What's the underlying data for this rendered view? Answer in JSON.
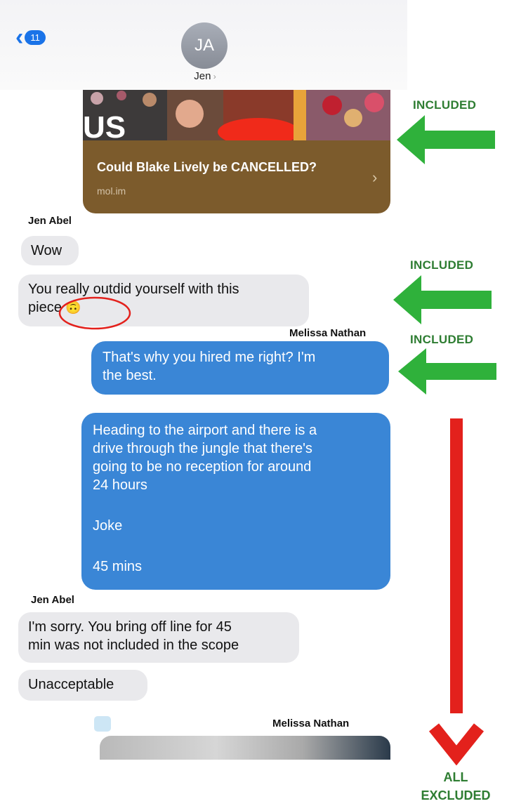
{
  "header": {
    "back_badge": "11",
    "avatar_initials": "JA",
    "contact_name": "Jen"
  },
  "link_preview": {
    "image_text": "US",
    "title": "Could Blake Lively be CANCELLED?",
    "domain": "mol.im"
  },
  "messages": [
    {
      "sender": "Jen Abel",
      "text": "Wow"
    },
    {
      "text_line1": "You really outdid yourself with this",
      "text_line2": "piece",
      "emoji": "🙃"
    },
    {
      "sender": "Melissa Nathan",
      "text_line1": "That's why you hired  me right? I'm",
      "text_line2": "the best."
    },
    {
      "lines": [
        "Heading to the airport and there is a",
        "drive through the jungle that there's",
        "going to be no reception for around",
        "24 hours",
        "",
        "Joke",
        "",
        "45 mins"
      ]
    },
    {
      "sender": "Jen Abel",
      "text_line1": "I'm sorry. You bring off line for 45",
      "text_line2": "min was not included in the scope"
    },
    {
      "text": "Unacceptable"
    },
    {
      "sender": "Melissa Nathan"
    }
  ],
  "annotations": {
    "label1": "INCLUDED",
    "label2": "INCLUDED",
    "label3": "INCLUDED",
    "excluded_line1": "ALL",
    "excluded_line2": "EXCLUDED",
    "green": "#2fb13b",
    "red": "#e3211c"
  }
}
